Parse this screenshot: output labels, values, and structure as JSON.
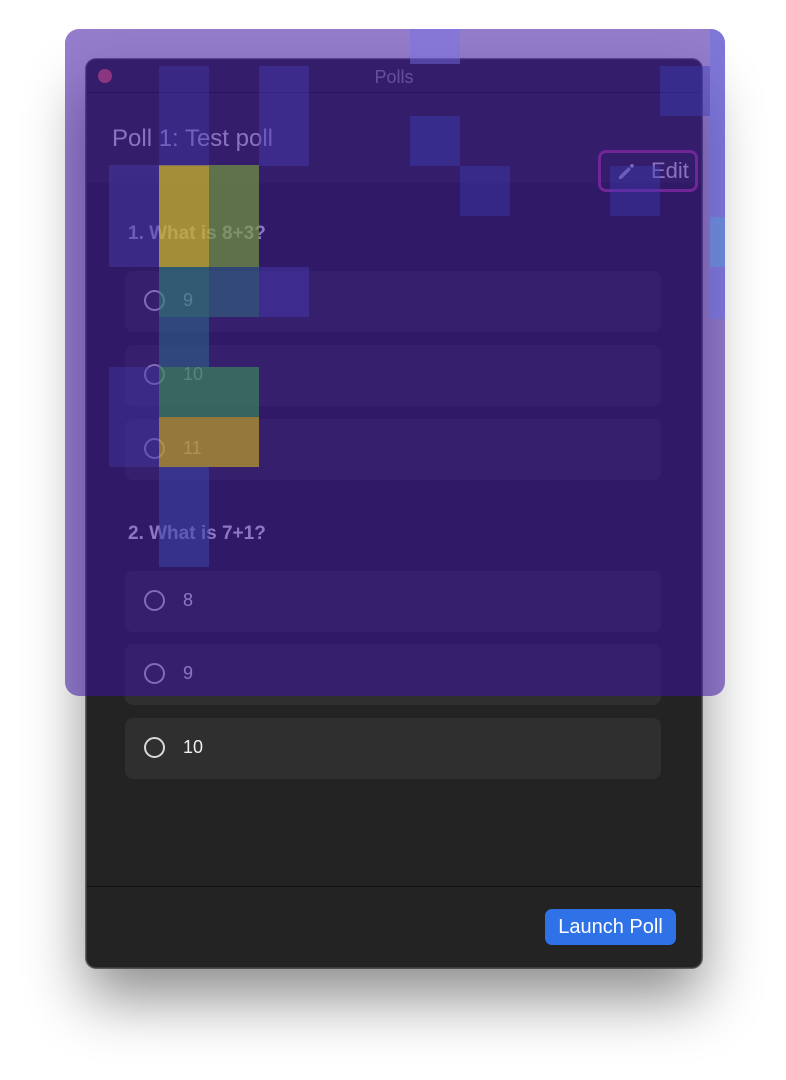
{
  "window": {
    "title": "Polls"
  },
  "header": {
    "poll_title": "Poll 1: Test poll",
    "edit_label": "Edit"
  },
  "questions": [
    {
      "title": "1. What is 8+3?",
      "options": [
        "9",
        "10",
        "11"
      ]
    },
    {
      "title": "2. What is 7+1?",
      "options": [
        "8",
        "9",
        "10"
      ]
    }
  ],
  "footer": {
    "launch_label": "Launch Poll"
  },
  "icons": {
    "edit": "pencil-icon",
    "close": "close-dot-icon",
    "radio": "radio-unchecked-icon"
  },
  "colors": {
    "accent": "#2f71e6",
    "edit_border": "#b33a8a",
    "close": "#ec5f5c",
    "overlay": "#3c14a0"
  }
}
